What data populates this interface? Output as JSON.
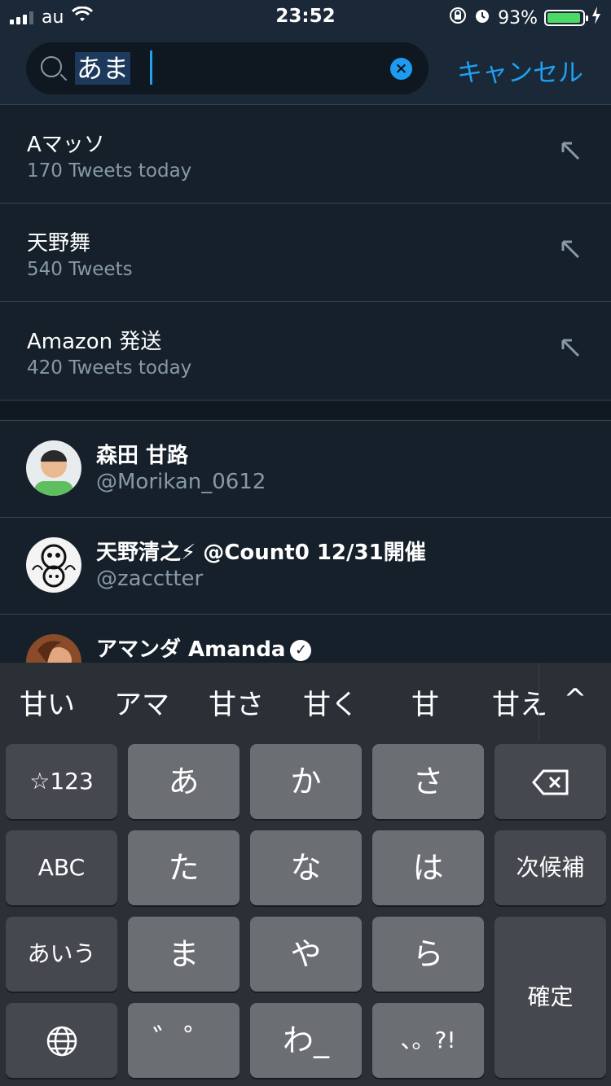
{
  "status_bar": {
    "carrier": "au",
    "time": "23:52",
    "battery": "93%"
  },
  "search": {
    "query": "あま",
    "cancel_label": "キャンセル"
  },
  "suggestions": [
    {
      "title": "Aマッソ",
      "subtitle": "170 Tweets today"
    },
    {
      "title": "天野舞",
      "subtitle": "540 Tweets"
    },
    {
      "title": "Amazon 発送",
      "subtitle": "420 Tweets today"
    }
  ],
  "users": [
    {
      "name": "森田 甘路",
      "handle": "@Morikan_0612"
    },
    {
      "name": "天野清之⚡ @Count0 12/31開催",
      "handle": "@zacctter"
    },
    {
      "name": "アマンダ Amanda",
      "handle": ""
    }
  ],
  "keyboard": {
    "candidates": [
      "甘い",
      "アマ",
      "甘さ",
      "甘く",
      "甘",
      "甘え"
    ],
    "expand_label": "^",
    "rows": [
      [
        "☆123",
        "あ",
        "か",
        "さ",
        "⌫"
      ],
      [
        "ABC",
        "た",
        "な",
        "は",
        "次候補"
      ],
      [
        "あいう",
        "ま",
        "や",
        "ら",
        "確定"
      ],
      [
        "🌐",
        "゛゜",
        "わ_",
        "、。?!"
      ]
    ],
    "labels": {
      "sym": "☆123",
      "a": "あ",
      "ka": "か",
      "sa": "さ",
      "abc": "ABC",
      "ta": "た",
      "na": "な",
      "ha": "は",
      "next": "次候補",
      "aiu": "あいう",
      "ma": "ま",
      "ya": "や",
      "ra": "ら",
      "confirm": "確定",
      "dakuten": "゛゜",
      "wa": "わ_",
      "punct": "、。?!"
    }
  }
}
